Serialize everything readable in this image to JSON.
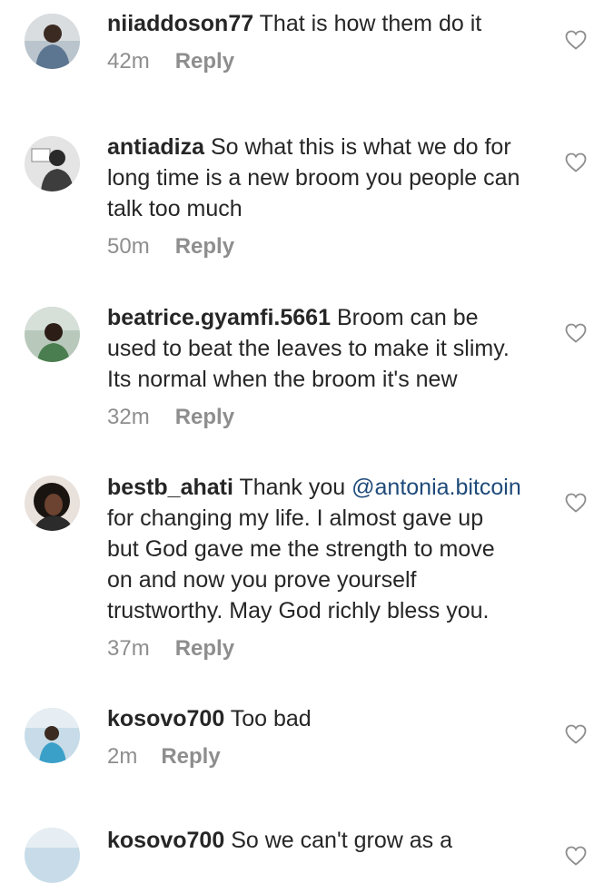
{
  "comments": [
    {
      "username": "niiaddoson77",
      "text": "That is how them do it",
      "time": "42m",
      "reply_label": "Reply",
      "avatar_icon": "user-avatar-photo"
    },
    {
      "username": "antiadiza",
      "text_line1": "So what this is what we do for",
      "text_line2": "long time is a new broom you people can",
      "text_line3": "talk too much",
      "time": "50m",
      "reply_label": "Reply",
      "avatar_icon": "user-avatar-photo"
    },
    {
      "username": "beatrice.gyamfi.5661",
      "text_line1": "Broom can be",
      "text_line2": "used to beat the leaves to make it slimy.",
      "text_line3": "Its normal when the broom it's new",
      "time": "32m",
      "reply_label": "Reply",
      "avatar_icon": "user-avatar-photo"
    },
    {
      "username": "bestb_ahati",
      "text_before_mention": "Thank you",
      "mention": "@antonia.bitcoin",
      "text_line2": "for changing my life. I almost gave up",
      "text_line3": "but God gave me the strength to move",
      "text_line4": "on and now you prove yourself",
      "text_line5": "trustworthy. May God richly bless you.",
      "time": "37m",
      "reply_label": "Reply",
      "avatar_icon": "user-avatar-photo"
    },
    {
      "username": "kosovo700",
      "text": "Too bad",
      "time": "2m",
      "reply_label": "Reply",
      "avatar_icon": "user-avatar-photo"
    },
    {
      "username": "kosovo700",
      "text": "So we can't grow as a",
      "avatar_icon": "user-avatar-photo"
    }
  ],
  "icons": {
    "like": "heart-outline-icon"
  },
  "colors": {
    "text": "#262626",
    "meta": "#8e8e8e",
    "mention": "#1e4a7a",
    "heart_stroke": "#8e8e8e"
  }
}
